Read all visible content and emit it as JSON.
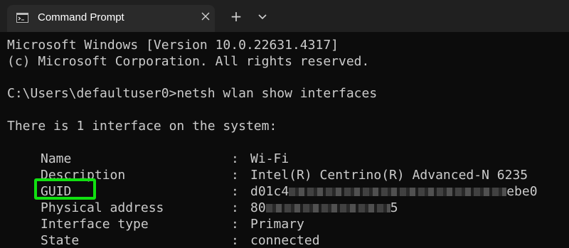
{
  "window": {
    "tab_title": "Command Prompt",
    "tab_icon": "terminal-icon",
    "close_icon": "close-icon",
    "new_tab_glyph": "+",
    "dropdown_icon": "chevron-down-icon"
  },
  "console": {
    "lines": [
      "Microsoft Windows [Version 10.0.22631.4317]",
      "(c) Microsoft Corporation. All rights reserved.",
      "C:\\Users\\defaultuser0>netsh wlan show interfaces",
      "There is 1 interface on the system:"
    ],
    "properties": [
      {
        "key": "Name",
        "sep": ":",
        "value": "Wi-Fi"
      },
      {
        "key": "Description",
        "sep": ":",
        "value": "Intel(R) Centrino(R) Advanced-N 6235"
      },
      {
        "key": "GUID",
        "sep": ":",
        "value_prefix": "d01c4",
        "value_suffix": "ebe0"
      },
      {
        "key": "Physical address",
        "sep": ":",
        "value_prefix": "80",
        "value_suffix": "5"
      },
      {
        "key": "Interface type",
        "sep": ":",
        "value": "Primary"
      },
      {
        "key": "State",
        "sep": ":",
        "value": "connected"
      }
    ]
  },
  "colors": {
    "highlight": "#11e011",
    "console_text": "#cccccc",
    "background": "#0c0c0c"
  }
}
